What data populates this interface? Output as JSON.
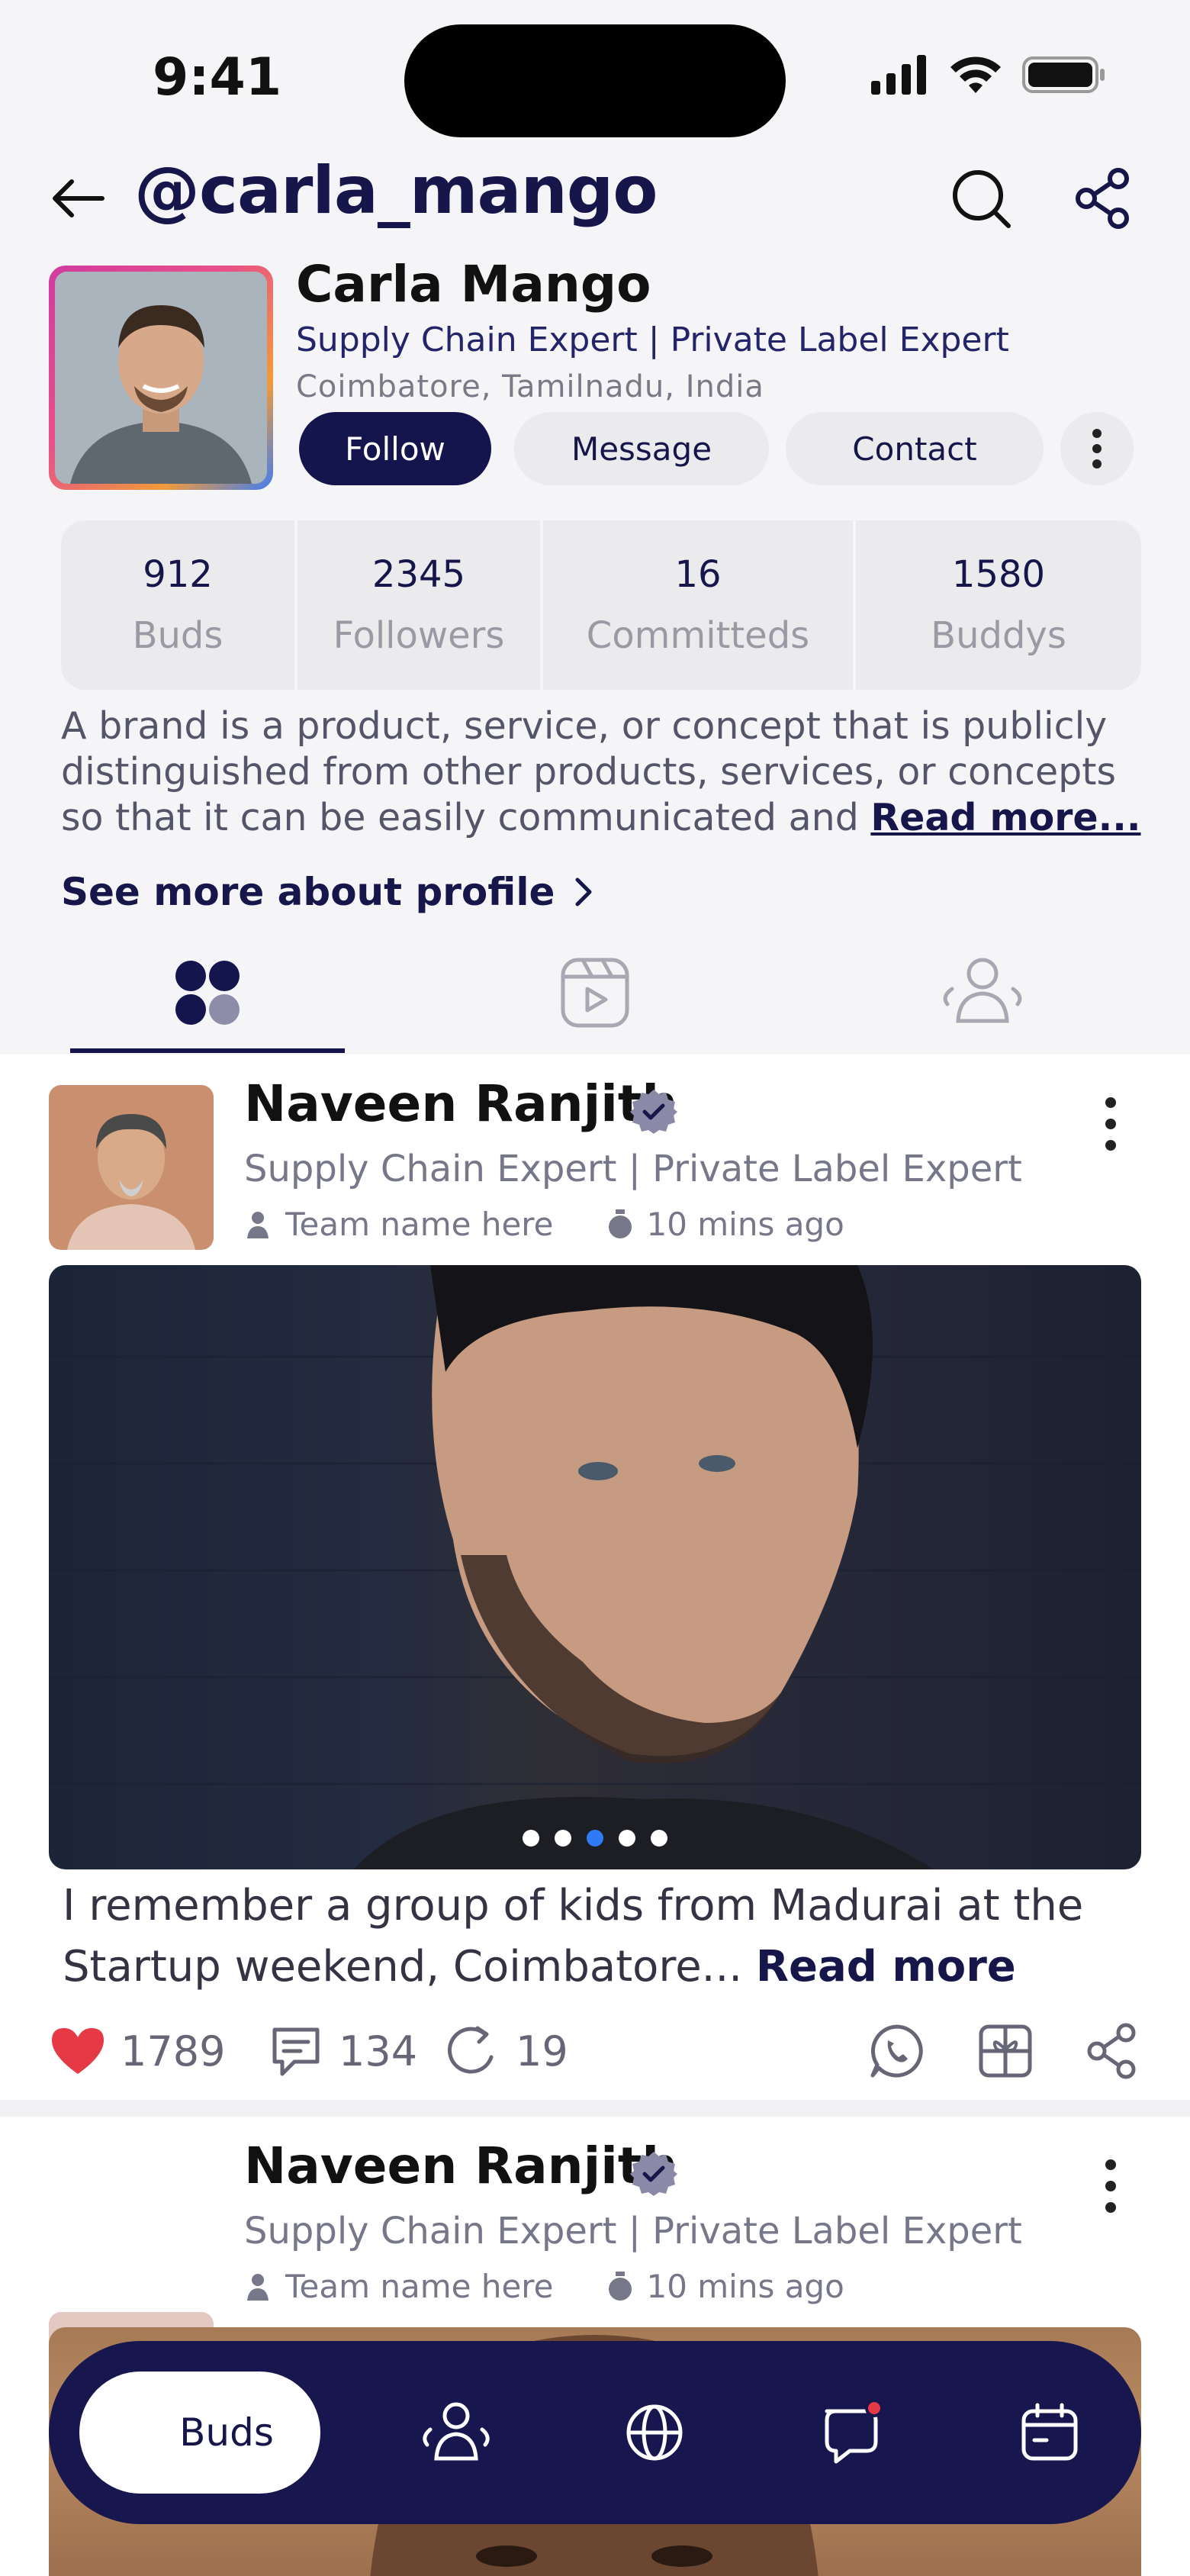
{
  "status_bar": {
    "time": "9:41"
  },
  "header": {
    "handle": "@carla_mango"
  },
  "profile": {
    "name": "Carla Mango",
    "title": "Supply Chain Expert | Private Label Expert",
    "location": "Coimbatore, Tamilnadu, India",
    "buttons": {
      "follow": "Follow",
      "message": "Message",
      "contact": "Contact"
    },
    "stats": [
      {
        "value": "912",
        "label": "Buds"
      },
      {
        "value": "2345",
        "label": "Followers"
      },
      {
        "value": "16",
        "label": "Committeds"
      },
      {
        "value": "1580",
        "label": "Buddys"
      }
    ],
    "bio": "A brand is a product, service, or concept that is publicly distinguished from other products, services, or concepts so that it can be easily communicated and ",
    "bio_more": "Read more...",
    "see_more": "See more about profile"
  },
  "tabs": {
    "active": "grid",
    "icons": [
      "grid-icon",
      "reels-icon",
      "people-icon"
    ]
  },
  "posts": [
    {
      "author": "Naveen Ranjith",
      "job": "Supply Chain Expert | Private Label Expert",
      "team": "Team name here",
      "time": "10 mins ago",
      "caption": "I remember a group of kids from Madurai at the Startup weekend, Coimbatore... ",
      "read_more": "Read more",
      "likes": "1789",
      "comments": "134",
      "reposts": "19",
      "carousel": {
        "count": 5,
        "active": 3
      }
    },
    {
      "author": "Naveen Ranjith",
      "job": "Supply Chain Expert | Private Label Expert",
      "team": "Team name here",
      "time": "10 mins ago"
    }
  ],
  "bottom_nav": {
    "active_label": "Buds",
    "items": [
      "buds-icon",
      "people-icon",
      "globe-icon",
      "chat-icon",
      "calendar-icon"
    ]
  },
  "colors": {
    "primary": "#15154d",
    "like": "#e53945",
    "carousel_active": "#2f7bf6",
    "notification": "#e53945"
  }
}
